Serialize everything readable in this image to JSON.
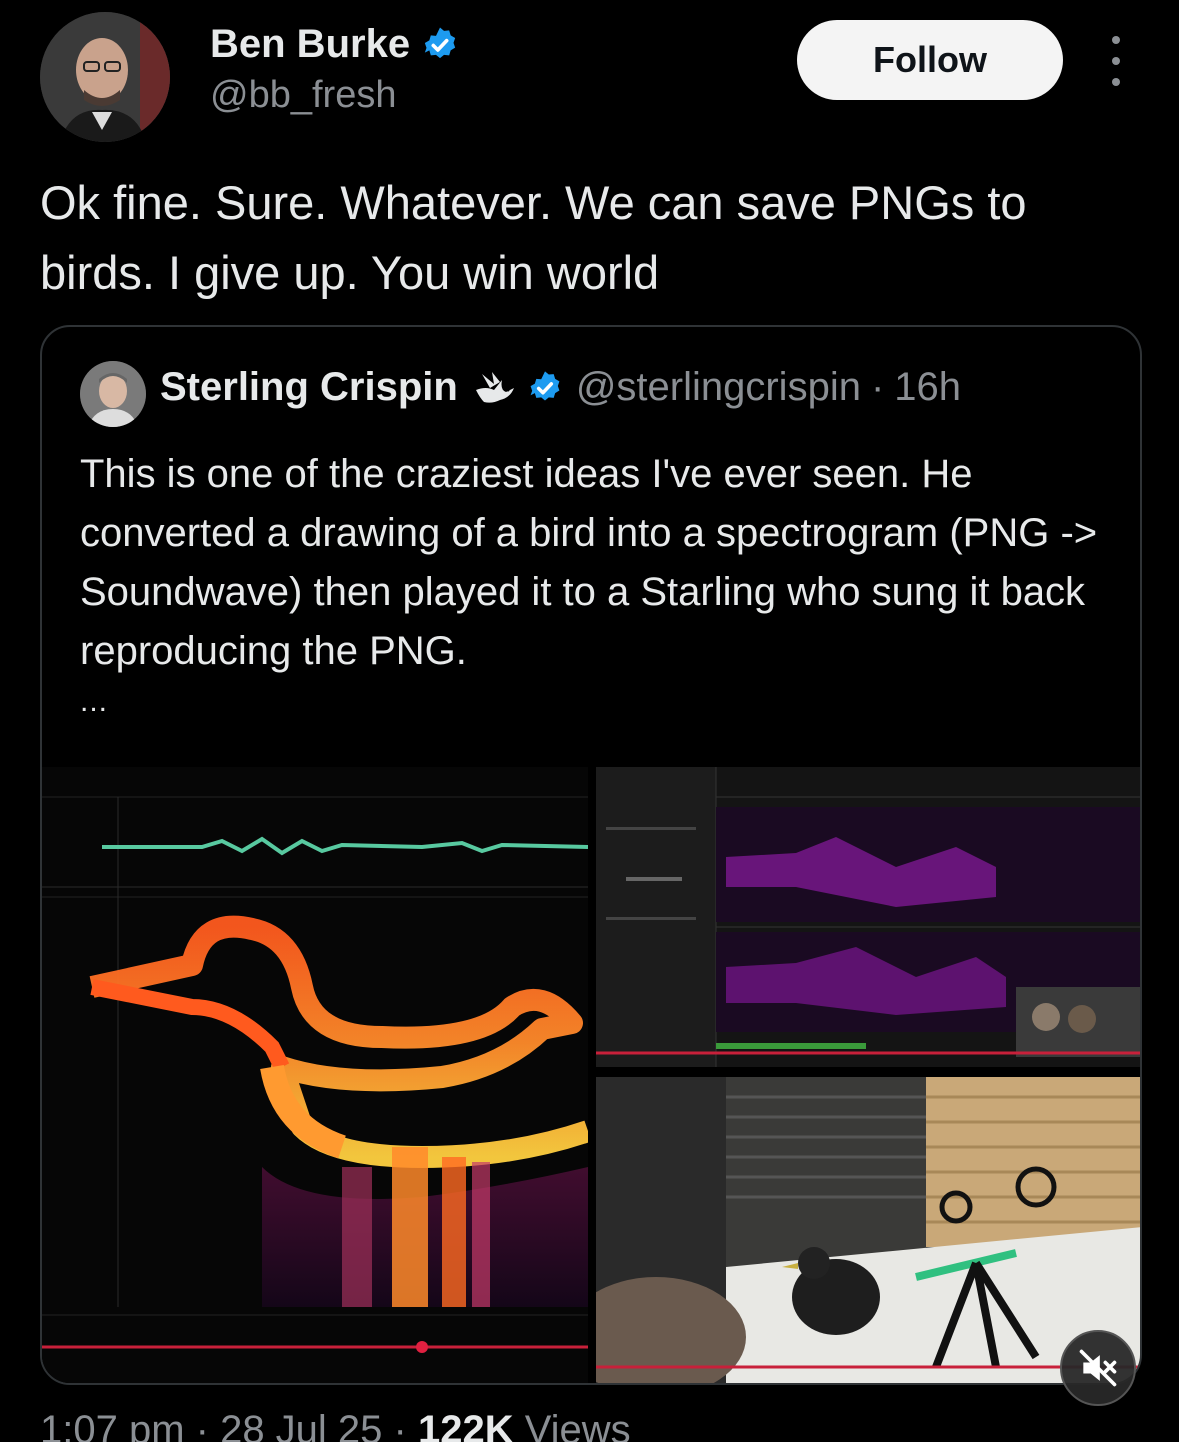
{
  "tweet": {
    "author_name": "Ben Burke",
    "author_handle": "@bb_fresh",
    "follow_label": "Follow",
    "text": "Ok fine. Sure. Whatever. We can save PNGs to birds. I give up. You win world",
    "timestamp": "1:07 pm · 28 Jul 25 · ",
    "views_count": "122K",
    "views_label": " Views"
  },
  "quote": {
    "author_name": "Sterling Crispin",
    "author_handle": "@sterlingcrispin",
    "separator": "·",
    "time": "16h",
    "text": "This is one of the craziest ideas I've ever seen. He converted a drawing of a bird into a spectrogram (PNG -> Soundwave) then played it to a Starling who sung it back reproducing the PNG.",
    "more": "..."
  },
  "icons": {
    "verified": "verified-badge-icon",
    "more": "more-vertical-icon",
    "dove": "dove-icon",
    "mute": "muted-speaker-icon"
  },
  "colors": {
    "verified": "#1d9bf0",
    "text": "#e7e9ea",
    "muted_text": "#8b8f94"
  }
}
